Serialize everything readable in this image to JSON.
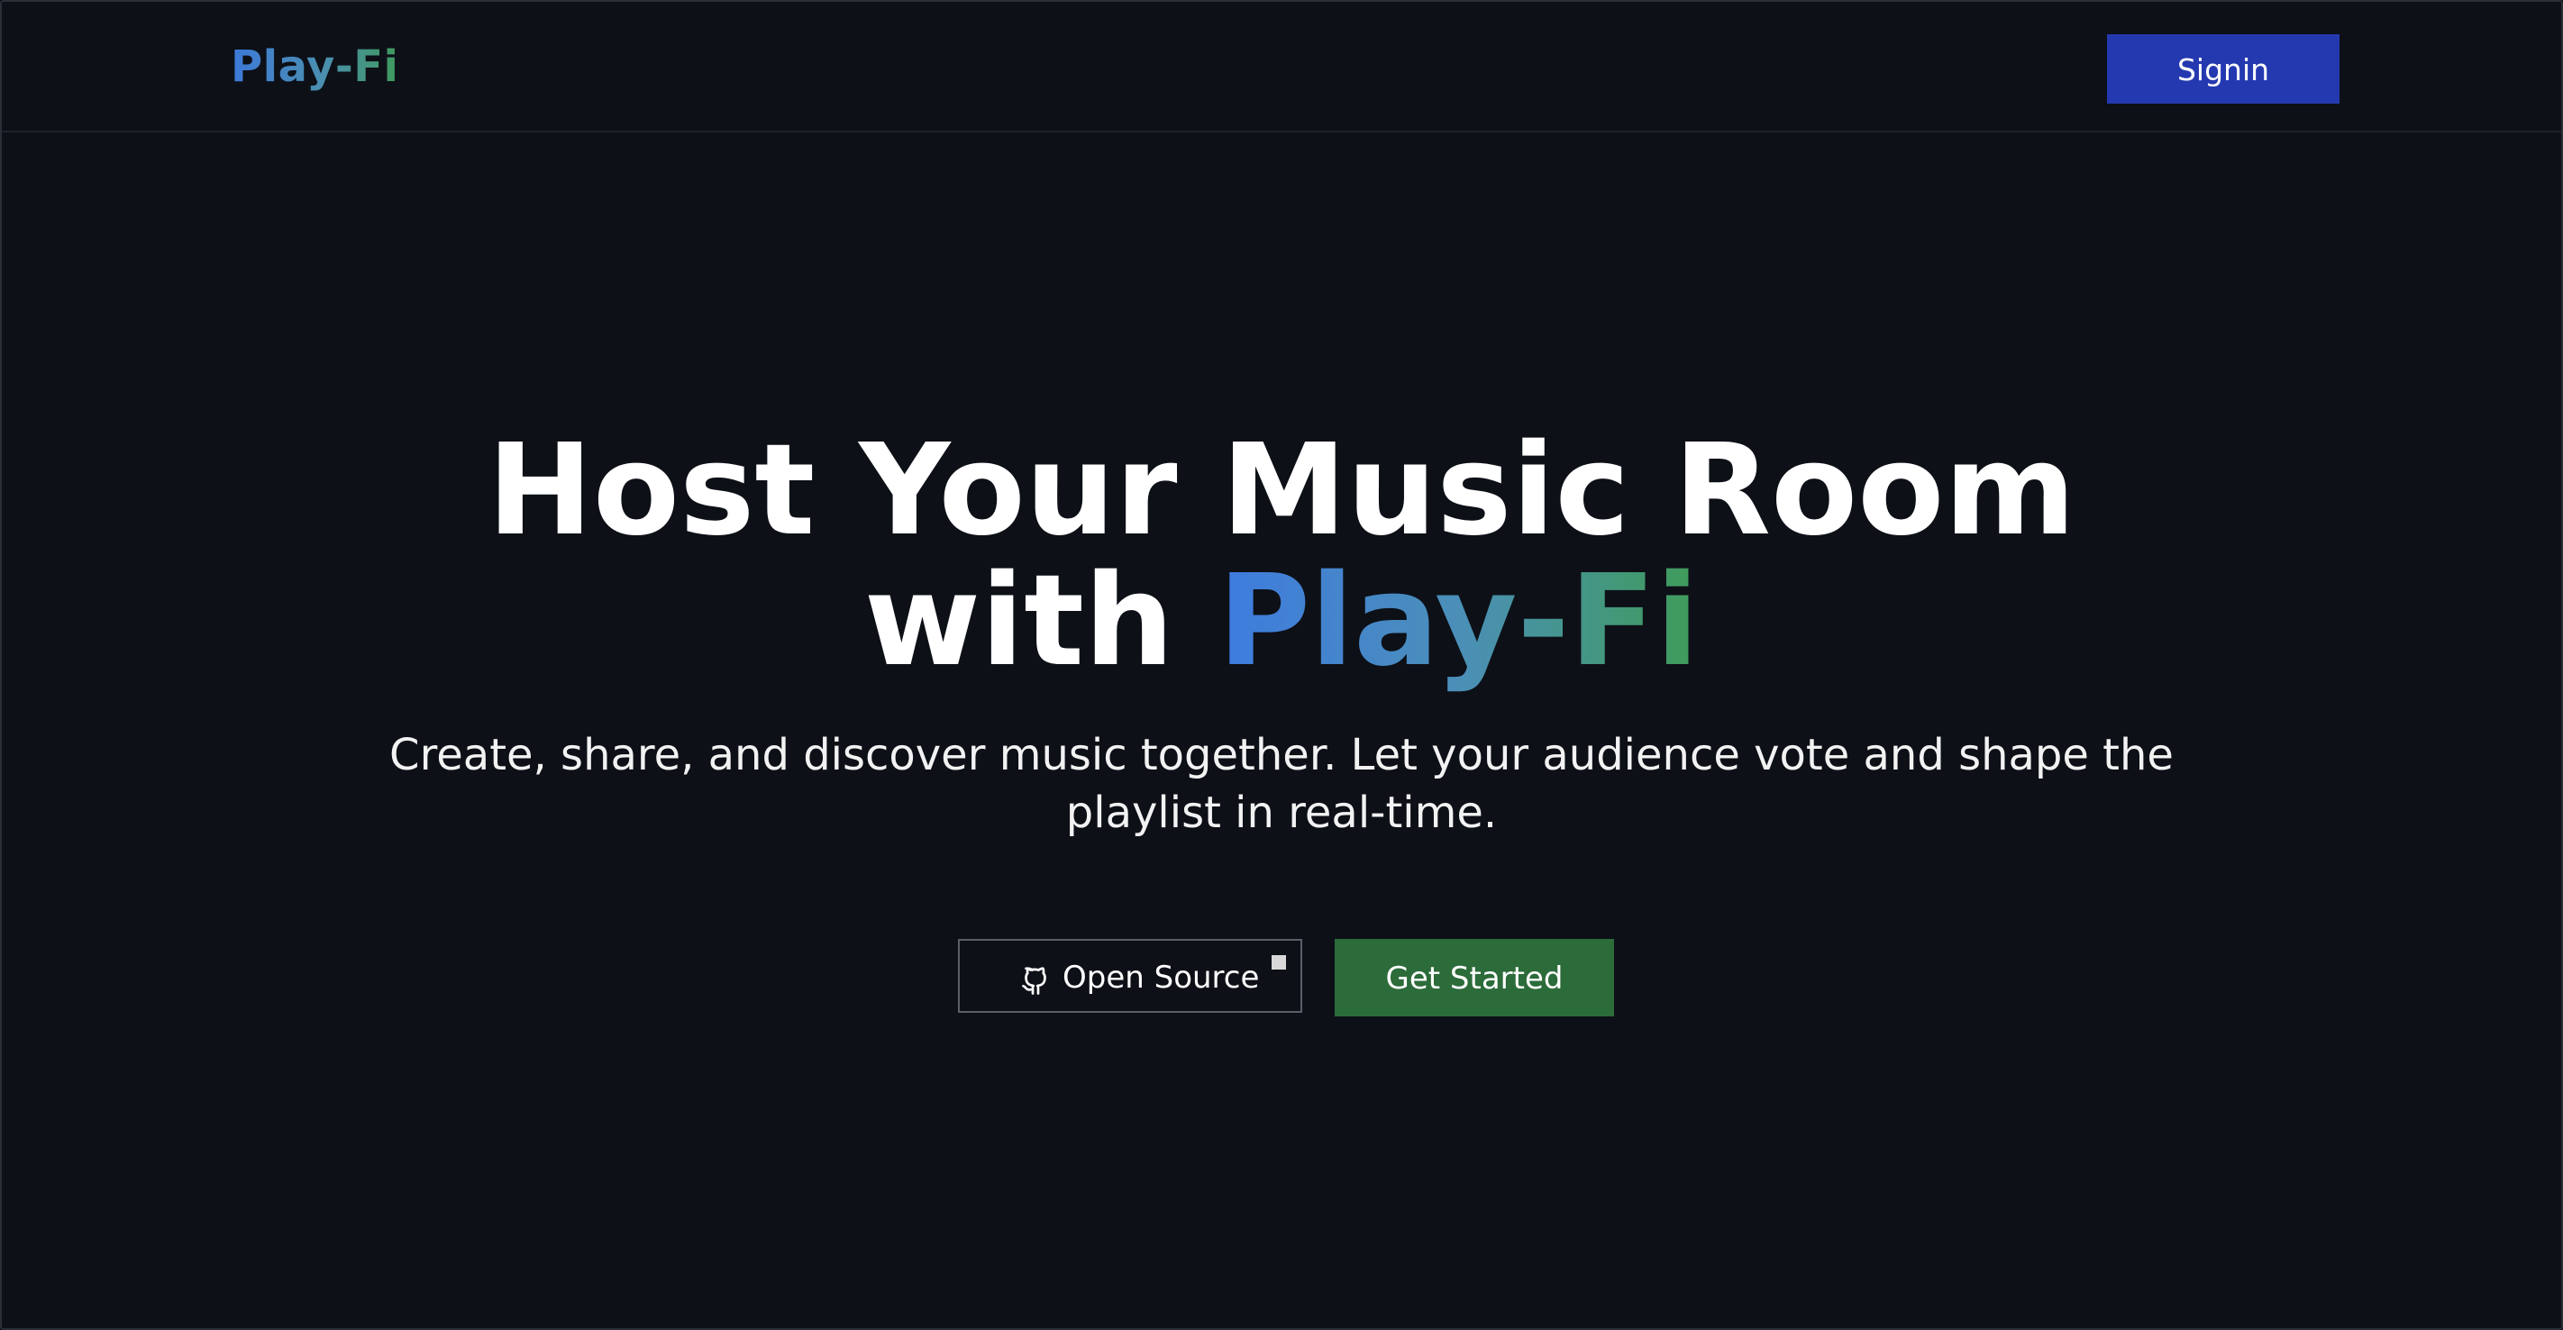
{
  "header": {
    "logo": "Play-Fi",
    "signin_label": "Signin"
  },
  "hero": {
    "headline_line1": "Host Your Music Room",
    "headline_with": "with",
    "headline_brand": "Play-Fi",
    "subtitle": "Create, share, and discover music together. Let your audience vote and shape the playlist in real-time."
  },
  "actions": {
    "open_source_label": "Open Source",
    "open_source_icon": "github-icon",
    "get_started_label": "Get Started"
  },
  "colors": {
    "background": "#0d1017",
    "signin_button": "#2439b0",
    "get_started_button": "#2c6b3a",
    "brand_gradient_start": "#3e7be0",
    "brand_gradient_end": "#3f9c58"
  }
}
